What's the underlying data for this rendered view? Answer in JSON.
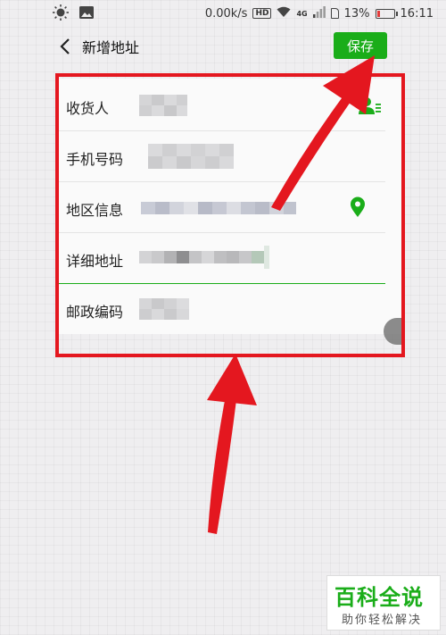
{
  "status_bar": {
    "speed": "0.00k/s",
    "hd": "HD",
    "network": "4G",
    "battery_percent": "13%",
    "time": "16:11"
  },
  "header": {
    "title": "新增地址",
    "save_label": "保存"
  },
  "form": {
    "rows": [
      {
        "label": "收货人"
      },
      {
        "label": "手机号码"
      },
      {
        "label": "地区信息"
      },
      {
        "label": "详细地址"
      },
      {
        "label": "邮政编码"
      }
    ]
  },
  "colors": {
    "accent": "#1aad19",
    "highlight": "#e4171f",
    "background": "#efeef0"
  },
  "icons": [
    "sun-icon",
    "image-icon",
    "wifi-icon",
    "signal-icon",
    "sim-icon",
    "battery-icon",
    "back-icon",
    "contact-icon",
    "location-pin-icon"
  ],
  "watermark": {
    "main": "百科全说",
    "sub": "助你轻松解决"
  }
}
